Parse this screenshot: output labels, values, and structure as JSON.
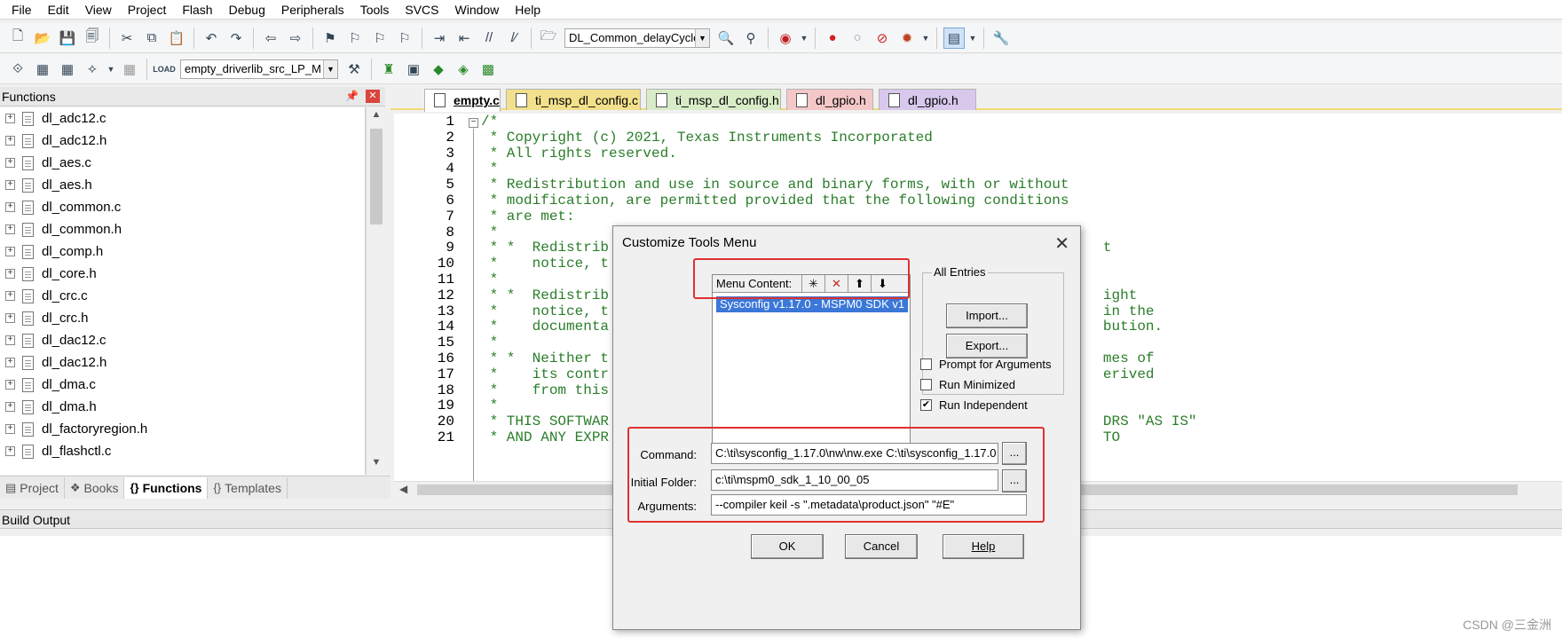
{
  "menubar": {
    "items": [
      "File",
      "Edit",
      "View",
      "Project",
      "Flash",
      "Debug",
      "Peripherals",
      "Tools",
      "SVCS",
      "Window",
      "Help"
    ]
  },
  "toolbar1": {
    "function_combo": "DL_Common_delayCycles"
  },
  "toolbar2": {
    "target_combo": "empty_driverlib_src_LP_M"
  },
  "functions_pane": {
    "title": "Functions",
    "items": [
      "dl_adc12.c",
      "dl_adc12.h",
      "dl_aes.c",
      "dl_aes.h",
      "dl_common.c",
      "dl_common.h",
      "dl_comp.h",
      "dl_core.h",
      "dl_crc.c",
      "dl_crc.h",
      "dl_dac12.c",
      "dl_dac12.h",
      "dl_dma.c",
      "dl_dma.h",
      "dl_factoryregion.h",
      "dl_flashctl.c"
    ],
    "tabs": [
      {
        "label": "Project",
        "icon": "project-icon"
      },
      {
        "label": "Books",
        "icon": "books-icon"
      },
      {
        "label": "Functions",
        "icon": "braces-icon"
      },
      {
        "label": "Templates",
        "icon": "template-icon"
      }
    ]
  },
  "editor": {
    "tabs": [
      {
        "label": "empty.c",
        "color": "#f2e08c"
      },
      {
        "label": "ti_msp_dl_config.c",
        "color": "#f2e08c"
      },
      {
        "label": "ti_msp_dl_config.h",
        "color": "#d8ecc8"
      },
      {
        "label": "dl_gpio.h",
        "color": "#f4c8c8"
      },
      {
        "label": "dl_gpio.h",
        "color": "#d8c8ec"
      }
    ],
    "line_numbers": [
      "1",
      "2",
      "3",
      "4",
      "5",
      "6",
      "7",
      "8",
      "9",
      "10",
      "11",
      "12",
      "13",
      "14",
      "15",
      "16",
      "17",
      "18",
      "19",
      "20",
      "21"
    ],
    "lines": [
      "/*",
      " * Copyright (c) 2021, Texas Instruments Incorporated",
      " * All rights reserved.",
      " *",
      " * Redistribution and use in source and binary forms, with or without",
      " * modification, are permitted provided that the following conditions",
      " * are met:",
      " *",
      " * *  Redistrib                                                          t",
      " *    notice, t",
      " *",
      " * *  Redistrib                                                          ight",
      " *    notice, t                                                          in the",
      " *    documenta                                                          bution.",
      " *",
      " * *  Neither t                                                          mes of",
      " *    its contr                                                          erived",
      " *    from this",
      " *",
      " * THIS SOFTWAR                                                          DRS \"AS IS\"",
      " * AND ANY EXPR                                                          TO"
    ]
  },
  "build_output": {
    "title": "Build Output"
  },
  "watermark": "CSDN @三金洲",
  "dialog": {
    "title": "Customize Tools Menu",
    "menu_content_label": "Menu Content:",
    "selected_entry": "Sysconfig v1.17.0 - MSPM0 SDK v1",
    "all_entries_label": "All Entries",
    "import_label": "Import...",
    "export_label": "Export...",
    "options": [
      {
        "label": "Prompt for  Arguments",
        "checked": false
      },
      {
        "label": "Run Minimized",
        "checked": false
      },
      {
        "label": "Run Independent",
        "checked": true
      }
    ],
    "command_label": "Command:",
    "command_value": "C:\\ti\\sysconfig_1.17.0\\nw\\nw.exe C:\\ti\\sysconfig_1.17.0",
    "folder_label": "Initial Folder:",
    "folder_value": "c:\\ti\\mspm0_sdk_1_10_00_05",
    "arguments_label": "Arguments:",
    "arguments_value": "--compiler keil -s \".metadata\\product.json\" \"#E\"",
    "browse_label": "...",
    "ok_label": "OK",
    "cancel_label": "Cancel",
    "help_label": "Help"
  }
}
